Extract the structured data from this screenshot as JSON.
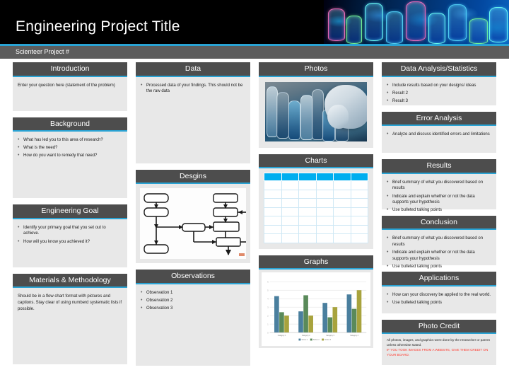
{
  "header": {
    "title": "Engineering Project Title",
    "subtitle": "Scienteer Project #",
    "accent_color": "#29a3d4",
    "banner_bg": "#000000",
    "banner_image": "test-tubes-glowing-blue-photo"
  },
  "theme": {
    "heading_bg": "#4d4d4d",
    "heading_text": "#ffffff",
    "body_bg": "#e8e8e8",
    "accent": "#29a3d4",
    "table_header": "#00aeef",
    "warning_text": "#ff3b30"
  },
  "columns": [
    {
      "name": "column-1",
      "sections": [
        {
          "id": "introduction",
          "title": "Introduction",
          "type": "paragraph",
          "text": "Enter your question here (statement of the problem)"
        },
        {
          "id": "background",
          "title": "Background",
          "type": "bullets",
          "items": [
            "What has led you to this area of research?",
            "What is the need?",
            "How do you want to remedy that need?"
          ]
        },
        {
          "id": "engineering-goal",
          "title": "Engineering Goal",
          "type": "bullets",
          "items": [
            "Identify your primary goal that you set out to achieve.",
            "How will you know you achieved it?"
          ]
        },
        {
          "id": "materials-methodology",
          "title": "Materials & Methodology",
          "type": "paragraph",
          "text": "Should be in a flow chart format with pictures and captions. Stay clear of using numberd systematic lists if possible."
        }
      ]
    },
    {
      "name": "column-2",
      "sections": [
        {
          "id": "data",
          "title": "Data",
          "type": "bullets",
          "items": [
            "Processed data of your findings. This should not be the raw data"
          ]
        },
        {
          "id": "desgins",
          "title": "Desgins",
          "type": "flowchart",
          "image": "flowchart-diagram-boxes-arrows"
        },
        {
          "id": "observations",
          "title": "Observations",
          "type": "bullets",
          "items": [
            "Observation 1",
            "Observation 2",
            "Observation 3"
          ]
        }
      ]
    },
    {
      "name": "column-3",
      "sections": [
        {
          "id": "photos",
          "title": "Photos",
          "type": "photo",
          "image": "gloved-hand-holding-test-tube-photo"
        },
        {
          "id": "charts",
          "title": "Charts",
          "type": "table",
          "table": {
            "columns": 6,
            "rows": 7,
            "header_labels": [
              "",
              "",
              "",
              "",
              "",
              ""
            ],
            "cells": []
          }
        },
        {
          "id": "graphs",
          "title": "Graphs",
          "type": "chart"
        }
      ]
    },
    {
      "name": "column-4",
      "sections": [
        {
          "id": "data-analysis-statistics",
          "title": "Data Analysis/Statistics",
          "type": "bullets",
          "items": [
            "Include results based on your designs/ ideas",
            "Result 2",
            "Result 3"
          ]
        },
        {
          "id": "error-analysis",
          "title": "Error Analysis",
          "type": "bullets",
          "items": [
            "Analyze and discuss identified errors and limitations"
          ]
        },
        {
          "id": "results",
          "title": "Results",
          "type": "bullets",
          "items": [
            "Brief summary of what you discovered based on results",
            "Indicate and explain whether or not the data supports your hypothesis",
            "Use bulleted talking points"
          ]
        },
        {
          "id": "conclusion",
          "title": "Conclusion",
          "type": "bullets",
          "items": [
            "Brief summary of what you discovered based on results",
            "Indicate and explain whether or not the data supports your hypothesis",
            "Use bulleted talking points"
          ]
        },
        {
          "id": "applications",
          "title": "Applications",
          "type": "bullets",
          "items": [
            "How can your discovery be applied to the real world.",
            "Use bulleted talking points"
          ]
        },
        {
          "id": "photo-credit",
          "title": "Photo Credit",
          "type": "credit",
          "text": "All photos, images, and graphics were done by the researcher or parent unless otherwise stated.",
          "warning": "IF YOU TOOK IMAGES FROM A WEBSITE, GIVE THEM CREDIT ON YOUR BOARD."
        }
      ]
    }
  ],
  "chart_data": {
    "type": "bar",
    "title": "Graphs",
    "categories": [
      "Category 1",
      "Category 2",
      "Category 3",
      "Category 4"
    ],
    "series": [
      {
        "name": "Series 1",
        "values": [
          4.3,
          2.5,
          3.5,
          4.5
        ],
        "color": "#4a7f9e"
      },
      {
        "name": "Series 2",
        "values": [
          2.4,
          4.4,
          1.8,
          2.8
        ],
        "color": "#5a8a5a"
      },
      {
        "name": "Series 3",
        "values": [
          2.0,
          2.0,
          3.0,
          5.0
        ],
        "color": "#a8a33d"
      }
    ],
    "ylim": [
      0,
      6
    ],
    "yticks": [
      0,
      1,
      2,
      3,
      4,
      5,
      6
    ],
    "xlabel": "",
    "ylabel": "",
    "grid": true,
    "legend": "bottom"
  }
}
